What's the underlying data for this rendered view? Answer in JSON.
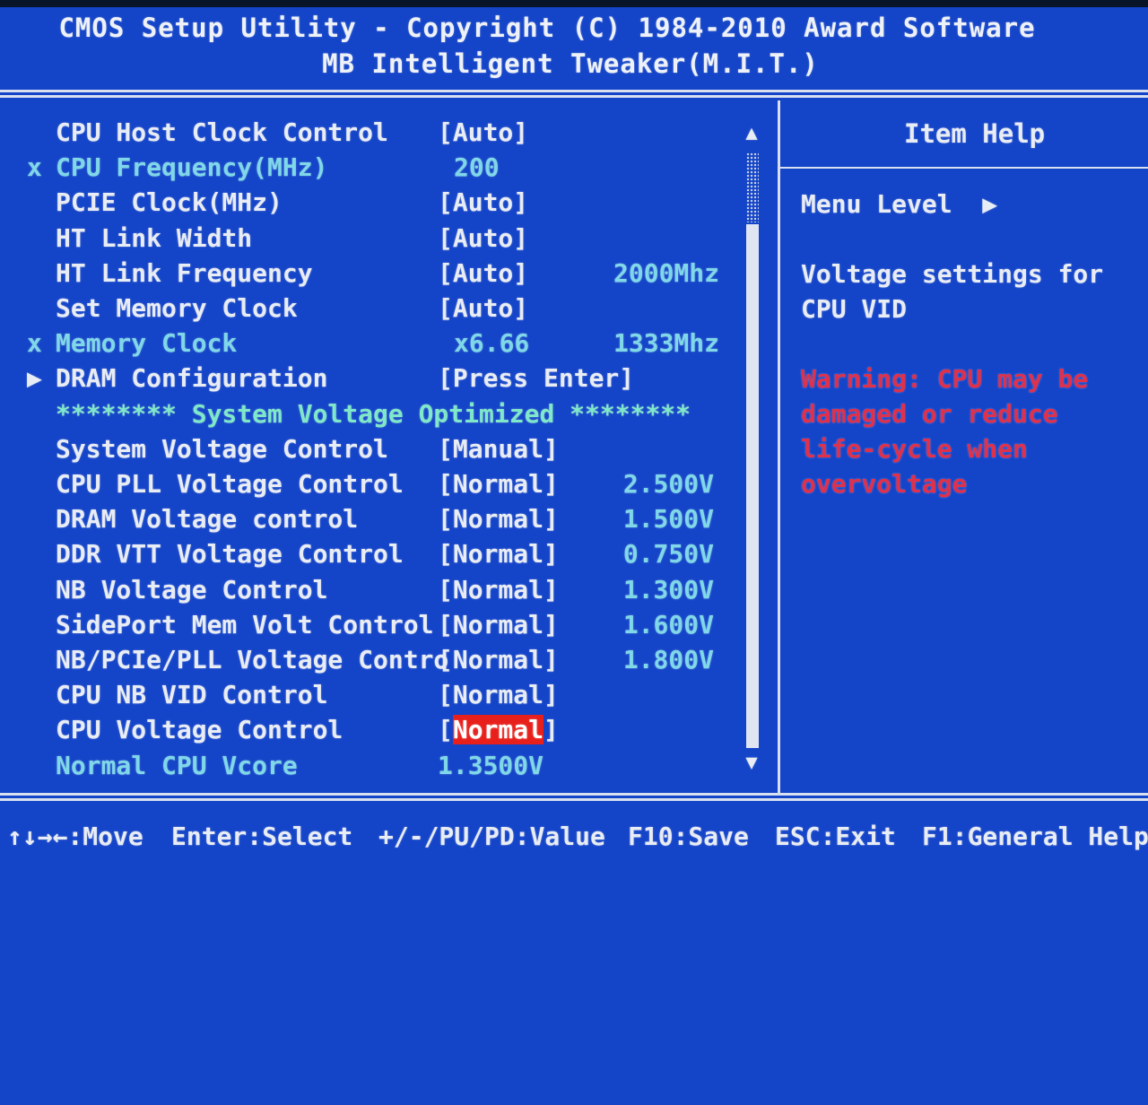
{
  "header": {
    "line1": "CMOS Setup Utility - Copyright (C) 1984-2010 Award Software",
    "line2": "MB Intelligent Tweaker(M.I.T.)"
  },
  "settings": [
    {
      "label": "CPU Host Clock Control",
      "value": "[Auto]",
      "extra": ""
    },
    {
      "label": "CPU Frequency(MHz)",
      "value": "200",
      "extra": "",
      "marker": "x"
    },
    {
      "label": "PCIE Clock(MHz)",
      "value": "[Auto]",
      "extra": ""
    },
    {
      "label": "HT Link Width",
      "value": "[Auto]",
      "extra": ""
    },
    {
      "label": "HT Link Frequency",
      "value": "[Auto]",
      "extra": "2000Mhz"
    },
    {
      "label": "Set Memory Clock",
      "value": "[Auto]",
      "extra": ""
    },
    {
      "label": "Memory Clock",
      "value": "x6.66",
      "extra": "1333Mhz",
      "marker": "x"
    },
    {
      "label": "DRAM Configuration",
      "value": "[Press Enter]",
      "extra": "",
      "marker": "▶"
    },
    {
      "section": "******** System Voltage Optimized ********"
    },
    {
      "label": "System Voltage Control",
      "value": "[Manual]",
      "extra": ""
    },
    {
      "label": "CPU PLL Voltage Control",
      "value": "[Normal]",
      "extra": "2.500V"
    },
    {
      "label": "DRAM Voltage control",
      "value": "[Normal]",
      "extra": "1.500V"
    },
    {
      "label": "DDR VTT Voltage Control",
      "value": "[Normal]",
      "extra": "0.750V"
    },
    {
      "label": "NB Voltage Control",
      "value": "[Normal]",
      "extra": "1.300V"
    },
    {
      "label": "SidePort Mem Volt Control",
      "value": "[Normal]",
      "extra": "1.600V"
    },
    {
      "label": "NB/PCIe/PLL Voltage Contro",
      "value": "[Normal]",
      "extra": "1.800V"
    },
    {
      "label": "CPU NB VID Control",
      "value": "[Normal]",
      "extra": ""
    },
    {
      "label": "CPU Voltage Control",
      "value": "[Normal]",
      "extra": "",
      "selected": true
    },
    {
      "label": "Normal CPU Vcore",
      "value": "1.3500V",
      "extra": "",
      "dim": true
    }
  ],
  "scroll": {
    "up": "▲",
    "down": "▼"
  },
  "help": {
    "title": "Item Help",
    "menu_level": "Menu Level  ▶",
    "desc_line1": "Voltage settings for",
    "desc_line2": "CPU VID",
    "warn_line1": "Warning: CPU may be",
    "warn_line2": "damaged or reduce",
    "warn_line3": "life-cycle when",
    "warn_line4": "overvoltage"
  },
  "footer": {
    "move": "↑↓→←:Move",
    "select": "Enter:Select",
    "value": "+/-/PU/PD:Value",
    "save": "F10:Save",
    "exit": "ESC:Exit",
    "help": "F1:General Help"
  },
  "colors": {
    "background": "#1444c8",
    "text": "#e8ecf4",
    "disabled": "#7fd8e8",
    "section": "#7fe8c8",
    "warning": "#e0304a",
    "highlight": "#e8201c"
  }
}
